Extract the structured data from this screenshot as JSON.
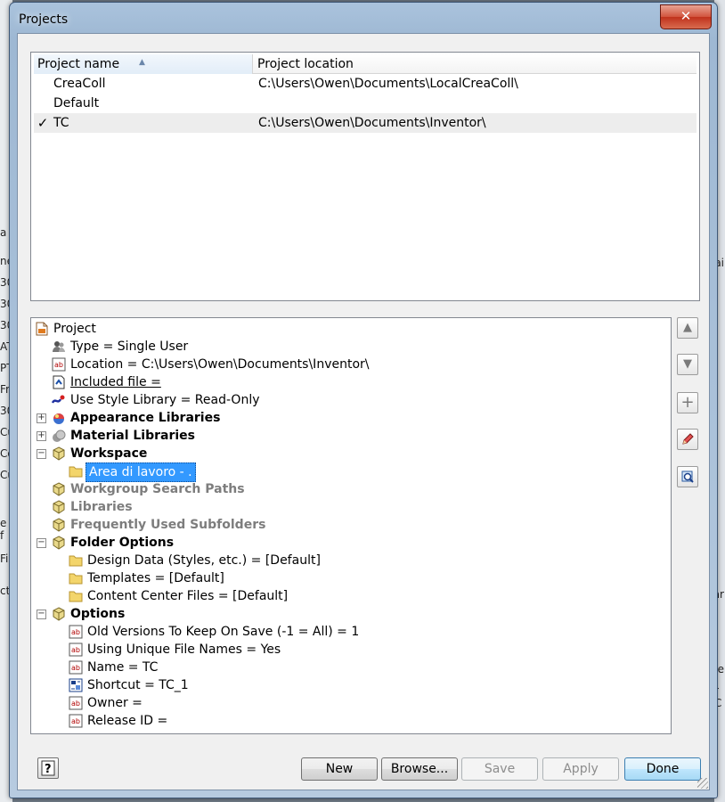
{
  "window": {
    "title": "Projects",
    "close_glyph": "✕"
  },
  "background_fragments": {
    "left": [
      "a",
      "ne",
      "30",
      "30",
      "30",
      "AT",
      "PT",
      "Fro",
      "30",
      "Cu",
      "Co",
      "Cu",
      "e f",
      "File",
      "ct"
    ],
    "right": [
      "ai",
      "ar",
      "ye",
      "r C"
    ]
  },
  "projects": {
    "columns": {
      "name": "Project name",
      "location": "Project location"
    },
    "sort_indicator": "▲",
    "rows": [
      {
        "active": "",
        "name": "CreaColl",
        "location": "C:\\Users\\Owen\\Documents\\LocalCreaColl\\"
      },
      {
        "active": "",
        "name": "Default",
        "location": ""
      },
      {
        "active": "✓",
        "name": "TC",
        "location": "C:\\Users\\Owen\\Documents\\Inventor\\"
      }
    ]
  },
  "tree": {
    "project": "Project",
    "type": "Type = Single User",
    "location": "Location = C:\\Users\\Owen\\Documents\\Inventor\\",
    "included_file": "Included file = ",
    "style_library": "Use Style Library = Read-Only",
    "appearance_libraries": "Appearance Libraries",
    "material_libraries": "Material Libraries",
    "workspace": "Workspace",
    "workspace_item": "Area di lavoro - .",
    "workgroup_search_paths": "Workgroup Search Paths",
    "libraries": "Libraries",
    "frequently_used_subfolders": "Frequently Used Subfolders",
    "folder_options": "Folder Options",
    "design_data": "Design Data (Styles, etc.) = [Default]",
    "templates": "Templates = [Default]",
    "content_center_files": "Content Center Files = [Default]",
    "options": "Options",
    "old_versions": "Old Versions To Keep On Save (-1 = All) = 1",
    "unique_file_names": "Using Unique File Names = Yes",
    "name": "Name = TC",
    "shortcut": "Shortcut = TC_1",
    "owner": "Owner = ",
    "release_id": "Release ID = ",
    "expand_glyph": "+",
    "collapse_glyph": "−"
  },
  "side_buttons": {
    "up": "▲",
    "down": "▼",
    "add": "+"
  },
  "buttons": {
    "help": "?",
    "new": "New",
    "browse": "Browse...",
    "save": "Save",
    "apply": "Apply",
    "done": "Done"
  },
  "colors": {
    "selection": "#3399ff",
    "folder": "#f3d56b",
    "frame": "#9eb8d3",
    "close": "#c94a32"
  }
}
